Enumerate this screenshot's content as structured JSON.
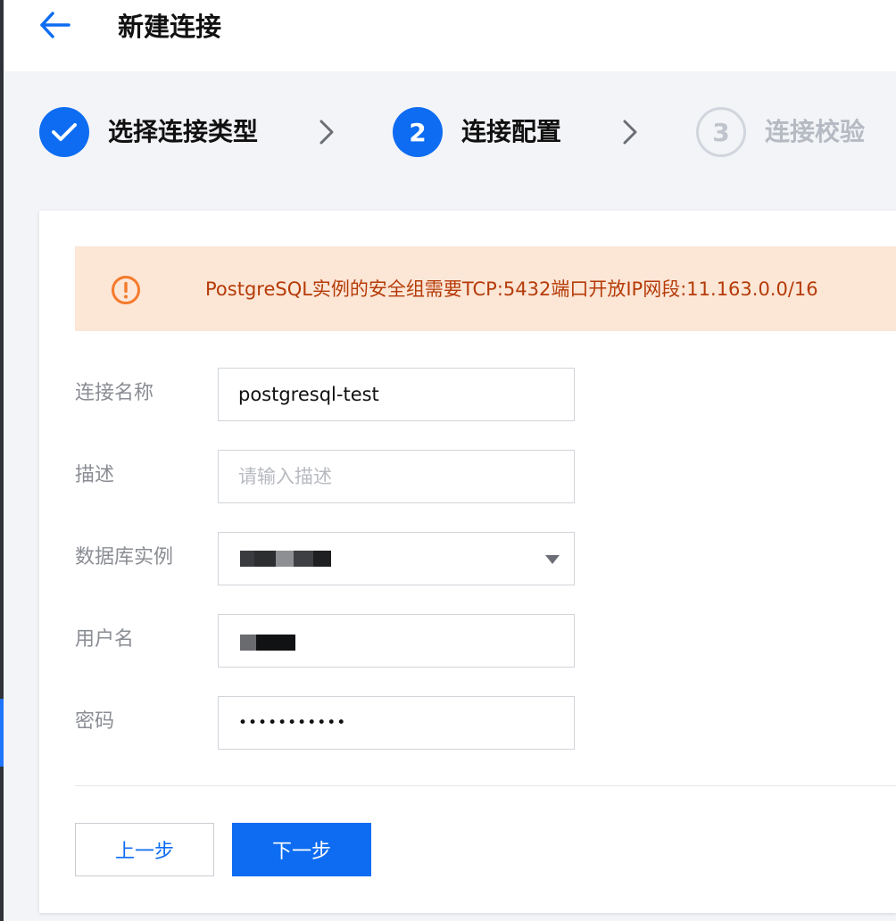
{
  "header": {
    "title": "新建连接",
    "back_icon": "arrow-left-icon"
  },
  "steps": [
    {
      "label": "选择连接类型",
      "state": "done",
      "marker": "✓"
    },
    {
      "label": "连接配置",
      "state": "active",
      "marker": "2"
    },
    {
      "label": "连接校验",
      "state": "pending",
      "marker": "3"
    }
  ],
  "alert": {
    "icon": "warning-circle-icon",
    "text": "PostgreSQL实例的安全组需要TCP:5432端口开放IP网段:11.163.0.0/16"
  },
  "form": {
    "connection_name": {
      "label": "连接名称",
      "value": "postgresql-test"
    },
    "description": {
      "label": "描述",
      "value": "",
      "placeholder": "请输入描述"
    },
    "db_instance": {
      "label": "数据库实例",
      "value_redacted": true
    },
    "username": {
      "label": "用户名",
      "value_redacted": true
    },
    "password": {
      "label": "密码",
      "value": "•••••••••••"
    }
  },
  "buttons": {
    "prev": "上一步",
    "next": "下一步"
  },
  "colors": {
    "primary": "#0d6cf2",
    "alert_bg": "#fce6d6",
    "alert_text": "#b53b08",
    "warning_icon": "#f57a2b"
  }
}
